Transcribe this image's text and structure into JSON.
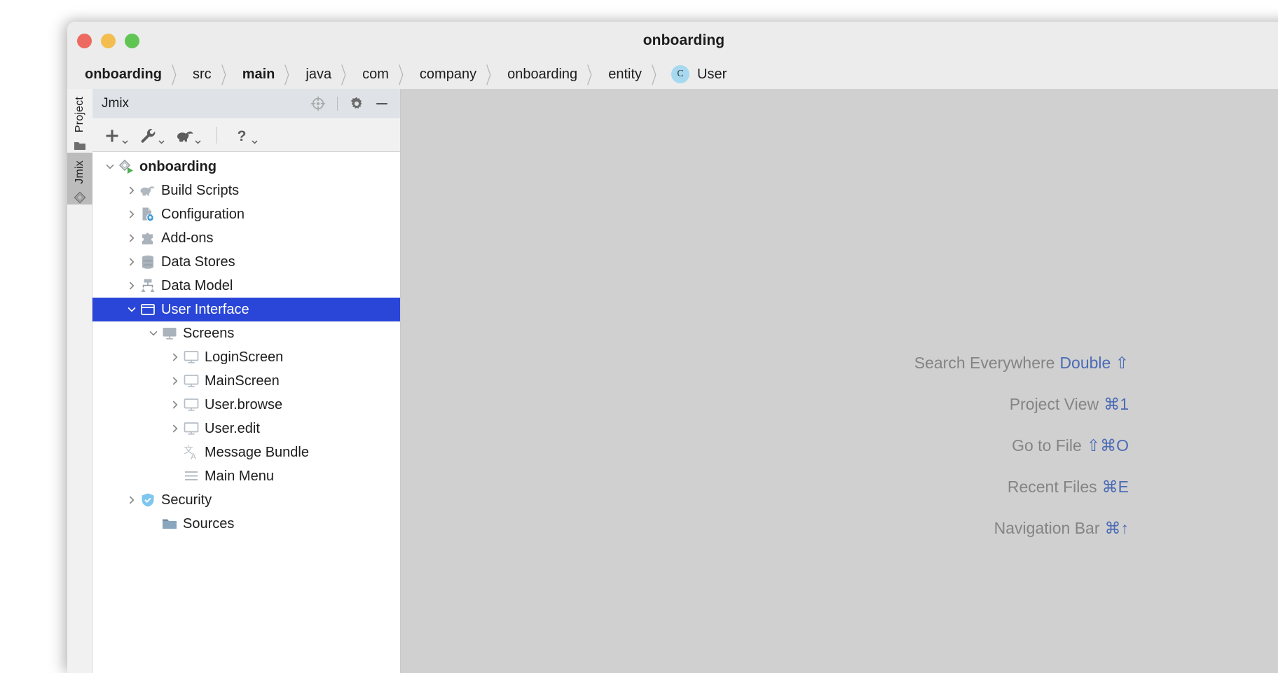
{
  "window": {
    "title": "onboarding",
    "traffic_lights": [
      {
        "name": "close",
        "color": "#ec6a5f"
      },
      {
        "name": "minimize",
        "color": "#f4bd4f"
      },
      {
        "name": "zoom",
        "color": "#61c554"
      }
    ]
  },
  "breadcrumb": {
    "separator": "〉",
    "items": [
      {
        "label": "onboarding",
        "bold": true,
        "badge": null
      },
      {
        "label": "src",
        "bold": false,
        "badge": null
      },
      {
        "label": "main",
        "bold": true,
        "badge": null
      },
      {
        "label": "java",
        "bold": false,
        "badge": null
      },
      {
        "label": "com",
        "bold": false,
        "badge": null
      },
      {
        "label": "company",
        "bold": false,
        "badge": null
      },
      {
        "label": "onboarding",
        "bold": false,
        "badge": null
      },
      {
        "label": "entity",
        "bold": false,
        "badge": null
      },
      {
        "label": "User",
        "bold": false,
        "badge": "C"
      }
    ]
  },
  "tool_strip": {
    "tabs": [
      {
        "label": "Project",
        "icon": "folder-icon",
        "active": false
      },
      {
        "label": "Jmix",
        "icon": "jmix-logo-icon",
        "active": true
      }
    ]
  },
  "jmix_panel": {
    "header": {
      "title": "Jmix",
      "actions": [
        {
          "name": "locate-icon",
          "glyph": "target"
        },
        {
          "name": "gear-icon",
          "glyph": "gear"
        },
        {
          "name": "minimize-icon",
          "glyph": "minus"
        }
      ]
    },
    "toolbar": {
      "buttons": [
        {
          "name": "new-icon",
          "glyph": "plus",
          "has_dropdown": true
        },
        {
          "name": "wrench-icon",
          "glyph": "wrench",
          "has_dropdown": true
        },
        {
          "name": "gradle-icon",
          "glyph": "elephant",
          "has_dropdown": true
        },
        {
          "name": "help-icon",
          "glyph": "question",
          "has_dropdown": true
        }
      ]
    },
    "tree": [
      {
        "label": "onboarding",
        "icon": "jmix-project-run-icon",
        "indent": 0,
        "arrow": "down",
        "bold": true,
        "selected": false
      },
      {
        "label": "Build Scripts",
        "icon": "gradle-elephant-icon",
        "indent": 1,
        "arrow": "right",
        "bold": false,
        "selected": false
      },
      {
        "label": "Configuration",
        "icon": "config-file-gear-icon",
        "indent": 1,
        "arrow": "right",
        "bold": false,
        "selected": false
      },
      {
        "label": "Add-ons",
        "icon": "puzzle-piece-icon",
        "indent": 1,
        "arrow": "right",
        "bold": false,
        "selected": false
      },
      {
        "label": "Data Stores",
        "icon": "database-icon",
        "indent": 1,
        "arrow": "right",
        "bold": false,
        "selected": false
      },
      {
        "label": "Data Model",
        "icon": "data-model-icon",
        "indent": 1,
        "arrow": "right",
        "bold": false,
        "selected": false
      },
      {
        "label": "User Interface",
        "icon": "window-frame-icon",
        "indent": 1,
        "arrow": "down",
        "bold": false,
        "selected": true
      },
      {
        "label": "Screens",
        "icon": "monitor-filled-icon",
        "indent": 2,
        "arrow": "down",
        "bold": false,
        "selected": false
      },
      {
        "label": "LoginScreen",
        "icon": "monitor-outline-icon",
        "indent": 3,
        "arrow": "right",
        "bold": false,
        "selected": false
      },
      {
        "label": "MainScreen",
        "icon": "monitor-outline-icon",
        "indent": 3,
        "arrow": "right",
        "bold": false,
        "selected": false
      },
      {
        "label": "User.browse",
        "icon": "monitor-outline-icon",
        "indent": 3,
        "arrow": "right",
        "bold": false,
        "selected": false
      },
      {
        "label": "User.edit",
        "icon": "monitor-outline-icon",
        "indent": 3,
        "arrow": "right",
        "bold": false,
        "selected": false
      },
      {
        "label": "Message Bundle",
        "icon": "translate-icon",
        "indent": 3,
        "arrow": "none",
        "bold": false,
        "selected": false
      },
      {
        "label": "Main Menu",
        "icon": "menu-lines-icon",
        "indent": 3,
        "arrow": "none",
        "bold": false,
        "selected": false
      },
      {
        "label": "Security",
        "icon": "shield-icon",
        "indent": 1,
        "arrow": "right",
        "bold": false,
        "selected": false
      },
      {
        "label": "Sources",
        "icon": "folder-blue-icon",
        "indent": 2,
        "arrow": "none",
        "bold": false,
        "selected": false
      }
    ]
  },
  "editor": {
    "shortcuts": [
      {
        "label": "Search Everywhere",
        "keys": "Double ⇧"
      },
      {
        "label": "Project View",
        "keys": "⌘1"
      },
      {
        "label": "Go to File",
        "keys": "⇧⌘O"
      },
      {
        "label": "Recent Files",
        "keys": "⌘E"
      },
      {
        "label": "Navigation Bar",
        "keys": "⌘↑"
      }
    ]
  },
  "colors": {
    "selection_blue": "#2a46d8",
    "shortcut_blue": "#4b6bb5",
    "editor_background": "#d0d0d0",
    "panel_header": "#dfe3e8",
    "badge_blue": "#a6d9ef"
  }
}
